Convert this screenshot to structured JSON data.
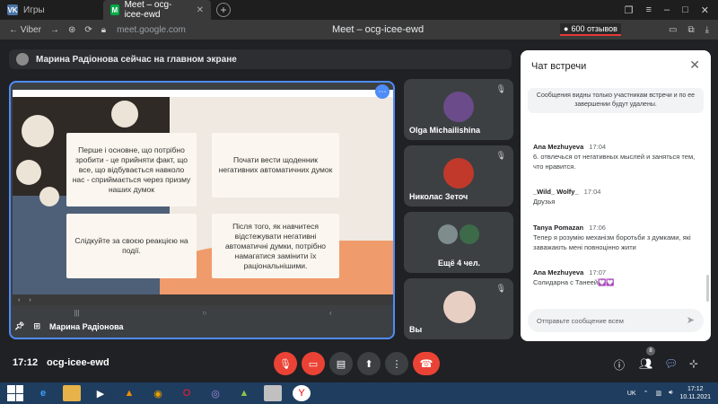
{
  "browser": {
    "tabs": [
      {
        "label": "Игры",
        "favicon": "VK",
        "favicon_color": "#4a76a8"
      },
      {
        "label": "Meet – ocg-icee-ewd",
        "favicon": "M",
        "favicon_color": "#00ac47"
      }
    ],
    "back_label": "Viber",
    "url": "meet.google.com",
    "page_title": "Meet – ocg-icee-ewd",
    "reviews": "600 отзывов"
  },
  "meet": {
    "presenting_notice": "Марина Радіонова сейчас на главном экране",
    "presenter_name": "Марина Радіонова",
    "slide": {
      "cards": [
        "Перше і основне, що потрібно зробити - це прийняти факт, що все, що відбувається навколо нас - сприймається через призму наших думок",
        "Почати вести щоденник негативних автоматичних думок",
        "Слідкуйте за своєю реакцією на події.",
        "Після того, як навчитеся відстежувати негативні автоматичні думки, потрібно намагатися замінити їх раціональнішими."
      ]
    },
    "participants": [
      {
        "name": "Olga Michailishina"
      },
      {
        "name": "Николас Зеточ"
      },
      {
        "name": "Ещё 4 чел."
      },
      {
        "name": "Вы"
      }
    ],
    "meeting_time": "17:12",
    "meeting_code": "ocg-icee-ewd",
    "people_count": "8"
  },
  "chat": {
    "title": "Чат встречи",
    "info": "Сообщения видны только участникам встречи и по ее завершении будут удалены.",
    "messages": [
      {
        "author": "Ana Mezhuyeva",
        "time": "17:04",
        "text": "6. отвлечься от негативных мыслей и заняться тем, что нравится."
      },
      {
        "author": "_Wild_ Wolfy_",
        "time": "17:04",
        "text": "Друзья"
      },
      {
        "author": "Tanya Pomazan",
        "time": "17:06",
        "text": "Тепер я розумію механізм боротьби з думками, які заважають мені повноцінно жити"
      },
      {
        "author": "Ana Mezhuyeva",
        "time": "17:07",
        "text": "Солидарна с Танеей💟💟"
      }
    ],
    "input_placeholder": "Отправьте сообщение всем"
  },
  "taskbar": {
    "lang": "UK",
    "time": "17:12",
    "date": "10.11.2021"
  },
  "colors": {
    "accent": "#4e8cf7",
    "danger": "#ea4335",
    "panel": "#3c4043"
  }
}
